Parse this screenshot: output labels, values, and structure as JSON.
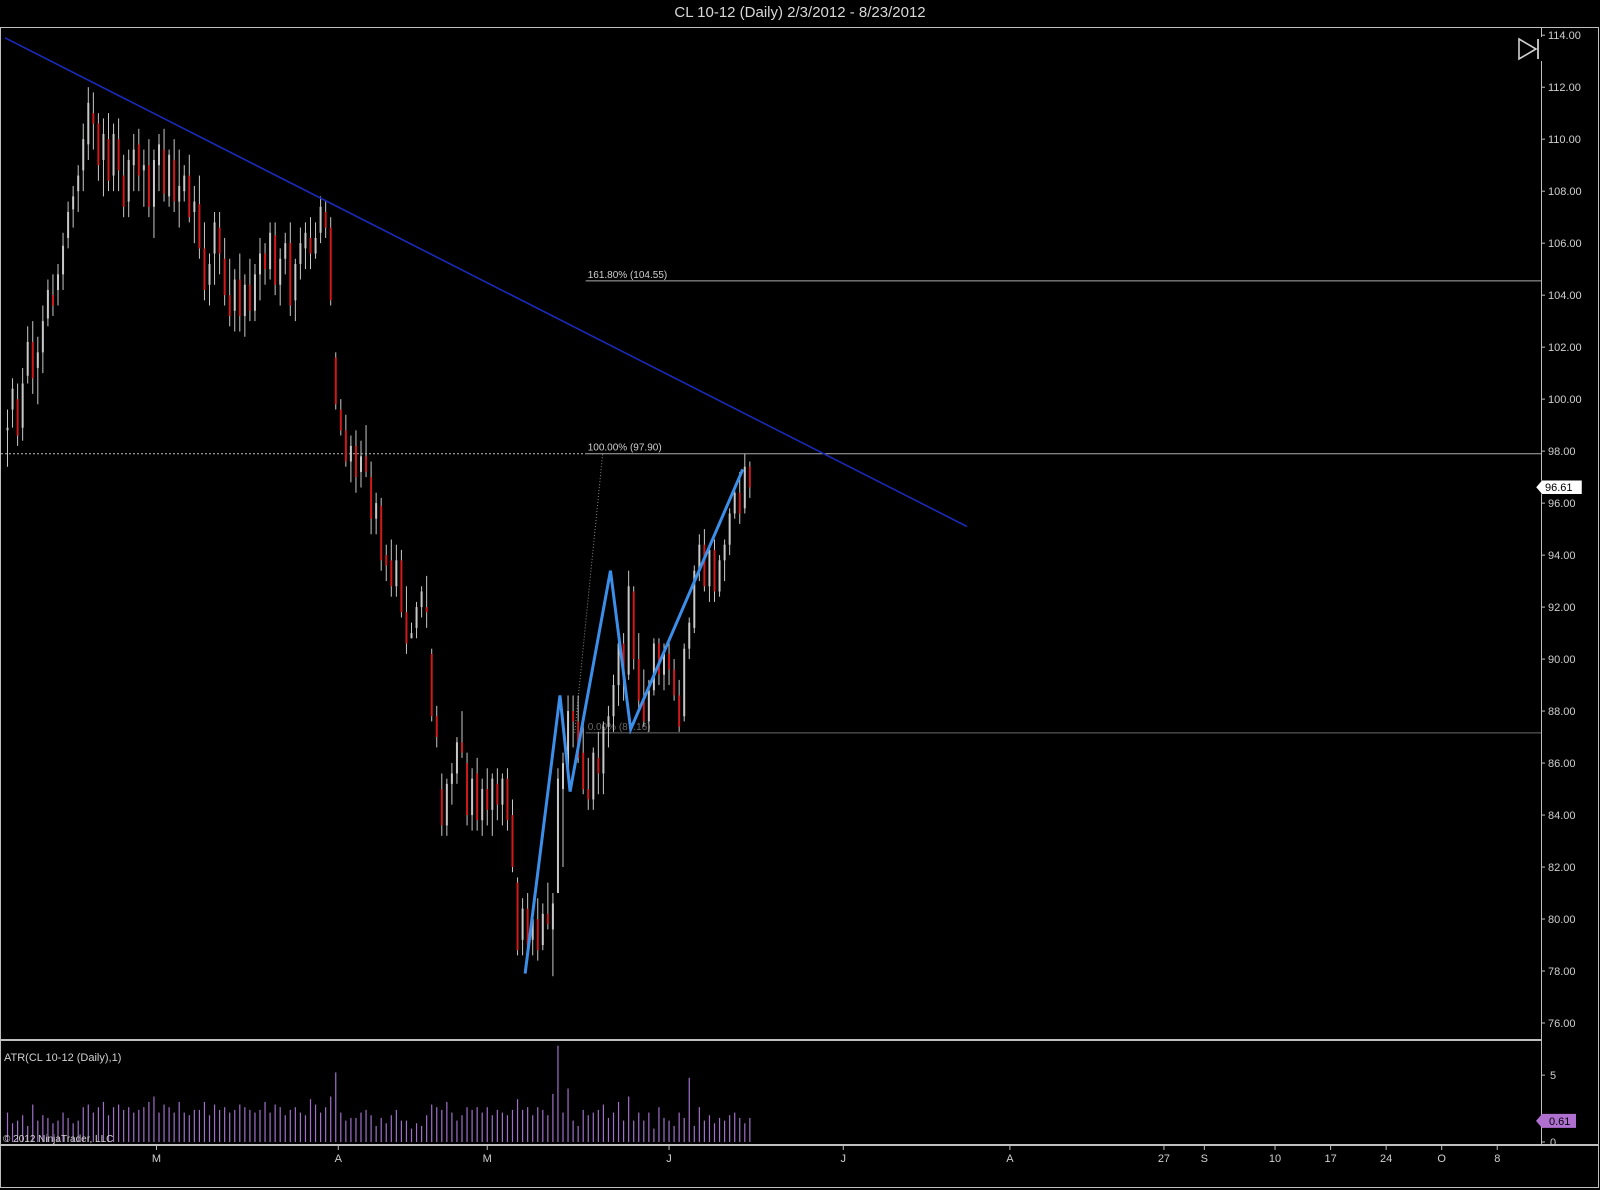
{
  "window": {
    "title": "CL 10-12 (Daily)  2/3/2012 - 8/23/2012"
  },
  "colors": {
    "background": "#000000",
    "up_bar": "#c8c8c8",
    "down_bar": "#d01a1a",
    "trendline": "#1a2ab8",
    "zigzag": "#3b8fe8",
    "fib": "#c0c0c0",
    "atr": "#a070c8",
    "price_marker": "#ffffff",
    "atr_marker": "#b070d0"
  },
  "chart_data": [
    {
      "type": "ohlc",
      "title": "CL 10-12 (Daily)  2/3/2012 - 8/23/2012",
      "ylim": [
        75.5,
        114.2
      ],
      "y_ticks": [
        "114.00",
        "112.00",
        "110.00",
        "108.00",
        "106.00",
        "104.00",
        "102.00",
        "100.00",
        "98.00",
        "96.00",
        "94.00",
        "92.00",
        "90.00",
        "88.00",
        "86.00",
        "84.00",
        "82.00",
        "80.00",
        "78.00",
        "76.00"
      ],
      "x_labels": [
        "M",
        "A",
        "M",
        "J",
        "J",
        "A",
        "27",
        "S",
        "10",
        "17",
        "24",
        "O",
        "8"
      ],
      "bars": [
        [
          98.8,
          99.6,
          97.4,
          98.9
        ],
        [
          99.6,
          100.8,
          98.9,
          100.4
        ],
        [
          100.0,
          100.6,
          98.2,
          98.6
        ],
        [
          98.9,
          101.2,
          98.4,
          100.6
        ],
        [
          100.9,
          102.8,
          100.6,
          102.2
        ],
        [
          102.2,
          103.0,
          100.2,
          100.8
        ],
        [
          101.2,
          102.4,
          99.8,
          101.8
        ],
        [
          101.8,
          103.6,
          101.0,
          103.0
        ],
        [
          103.1,
          104.6,
          102.8,
          104.2
        ],
        [
          104.0,
          104.8,
          103.2,
          103.6
        ],
        [
          104.2,
          105.2,
          103.6,
          104.8
        ],
        [
          104.8,
          106.4,
          104.2,
          105.9
        ],
        [
          106.2,
          107.6,
          105.8,
          107.2
        ],
        [
          107.3,
          108.2,
          106.6,
          107.8
        ],
        [
          108.0,
          109.0,
          107.2,
          108.6
        ],
        [
          108.8,
          110.6,
          108.0,
          110.0
        ],
        [
          109.8,
          112.0,
          109.2,
          111.4
        ],
        [
          111.0,
          111.8,
          109.6,
          110.6
        ],
        [
          110.6,
          111.0,
          108.4,
          109.0
        ],
        [
          109.2,
          110.8,
          107.8,
          110.2
        ],
        [
          110.0,
          111.0,
          108.0,
          108.4
        ],
        [
          108.6,
          110.6,
          108.0,
          110.2
        ],
        [
          110.0,
          110.8,
          108.0,
          108.8
        ],
        [
          108.6,
          109.4,
          107.0,
          107.4
        ],
        [
          107.6,
          109.6,
          107.0,
          109.2
        ],
        [
          109.0,
          110.2,
          108.0,
          109.6
        ],
        [
          109.8,
          110.4,
          108.0,
          108.6
        ],
        [
          108.8,
          109.6,
          107.4,
          109.0
        ],
        [
          109.0,
          110.0,
          107.0,
          107.4
        ],
        [
          107.4,
          109.6,
          106.2,
          109.2
        ],
        [
          109.0,
          110.2,
          108.0,
          109.8
        ],
        [
          109.6,
          110.4,
          107.6,
          107.9
        ],
        [
          107.8,
          109.6,
          107.4,
          109.4
        ],
        [
          109.2,
          110.0,
          107.2,
          107.6
        ],
        [
          107.6,
          109.6,
          106.6,
          108.2
        ],
        [
          108.0,
          109.0,
          107.6,
          108.6
        ],
        [
          108.6,
          109.4,
          106.8,
          107.0
        ],
        [
          107.2,
          108.2,
          106.0,
          107.6
        ],
        [
          107.5,
          108.6,
          105.4,
          105.8
        ],
        [
          105.8,
          106.8,
          103.8,
          104.2
        ],
        [
          104.4,
          105.6,
          103.6,
          105.2
        ],
        [
          105.6,
          107.2,
          104.4,
          106.8
        ],
        [
          106.6,
          107.2,
          104.8,
          105.6
        ],
        [
          105.4,
          106.2,
          103.6,
          104.0
        ],
        [
          104.0,
          105.4,
          102.8,
          103.2
        ],
        [
          103.4,
          105.0,
          102.6,
          104.6
        ],
        [
          104.6,
          105.6,
          102.6,
          103.2
        ],
        [
          103.2,
          104.8,
          102.4,
          104.4
        ],
        [
          104.4,
          105.4,
          103.0,
          103.4
        ],
        [
          103.4,
          105.2,
          103.0,
          104.8
        ],
        [
          104.8,
          106.2,
          103.8,
          105.6
        ],
        [
          105.6,
          106.0,
          104.4,
          105.0
        ],
        [
          105.0,
          106.8,
          104.6,
          106.4
        ],
        [
          106.3,
          106.8,
          104.0,
          104.4
        ],
        [
          104.4,
          105.8,
          103.6,
          105.4
        ],
        [
          105.4,
          106.4,
          104.8,
          106.0
        ],
        [
          106.0,
          106.8,
          103.2,
          103.6
        ],
        [
          103.8,
          105.4,
          103.0,
          105.2
        ],
        [
          105.2,
          106.6,
          104.6,
          106.0
        ],
        [
          105.8,
          106.8,
          105.0,
          106.4
        ],
        [
          106.2,
          107.0,
          105.0,
          105.6
        ],
        [
          105.6,
          106.8,
          105.4,
          106.2
        ],
        [
          106.4,
          107.8,
          106.0,
          107.4
        ],
        [
          107.2,
          107.6,
          106.2,
          106.6
        ],
        [
          106.6,
          107.0,
          103.6,
          103.8
        ],
        [
          101.6,
          101.8,
          99.6,
          99.8
        ],
        [
          99.6,
          100.0,
          98.6,
          98.8
        ],
        [
          98.8,
          99.4,
          97.4,
          97.6
        ],
        [
          97.6,
          98.6,
          96.8,
          98.2
        ],
        [
          98.2,
          98.8,
          96.4,
          97.0
        ],
        [
          97.2,
          98.4,
          96.6,
          97.8
        ],
        [
          97.8,
          99.0,
          97.0,
          97.2
        ],
        [
          97.0,
          97.6,
          94.8,
          95.4
        ],
        [
          95.4,
          96.4,
          94.8,
          96.0
        ],
        [
          95.9,
          96.2,
          93.4,
          93.8
        ],
        [
          94.0,
          94.4,
          93.0,
          93.6
        ],
        [
          93.8,
          94.6,
          92.4,
          92.8
        ],
        [
          92.8,
          94.4,
          92.4,
          93.8
        ],
        [
          93.8,
          94.2,
          91.6,
          91.8
        ],
        [
          91.8,
          92.8,
          90.2,
          90.6
        ],
        [
          90.8,
          91.4,
          90.8,
          91.0
        ],
        [
          91.2,
          92.2,
          90.8,
          92.0
        ],
        [
          92.0,
          92.8,
          91.6,
          92.6
        ],
        [
          92.0,
          93.2,
          91.2,
          91.8
        ],
        [
          90.2,
          90.4,
          87.6,
          87.8
        ],
        [
          87.8,
          88.2,
          86.6,
          87.0
        ],
        [
          85.0,
          85.6,
          83.2,
          83.6
        ],
        [
          83.6,
          85.4,
          83.2,
          85.2
        ],
        [
          85.2,
          86.0,
          84.4,
          85.6
        ],
        [
          85.6,
          87.0,
          85.2,
          86.8
        ],
        [
          86.8,
          88.0,
          86.2,
          86.4
        ],
        [
          86.0,
          86.4,
          83.6,
          84.0
        ],
        [
          84.0,
          85.8,
          83.4,
          85.4
        ],
        [
          85.6,
          86.2,
          83.4,
          83.8
        ],
        [
          83.8,
          85.4,
          83.2,
          85.0
        ],
        [
          85.0,
          85.8,
          83.6,
          84.2
        ],
        [
          84.2,
          85.6,
          83.2,
          85.4
        ],
        [
          85.2,
          85.8,
          83.8,
          84.4
        ],
        [
          84.4,
          85.6,
          83.6,
          85.4
        ],
        [
          85.4,
          85.8,
          83.4,
          83.8
        ],
        [
          84.0,
          84.6,
          81.8,
          82.0
        ],
        [
          81.4,
          81.6,
          78.6,
          78.8
        ],
        [
          79.2,
          80.8,
          78.6,
          80.4
        ],
        [
          80.4,
          81.0,
          78.4,
          79.0
        ],
        [
          79.2,
          80.4,
          78.6,
          80.0
        ],
        [
          80.0,
          80.8,
          78.4,
          78.8
        ],
        [
          79.0,
          80.6,
          78.8,
          80.2
        ],
        [
          80.2,
          81.4,
          79.6,
          79.8
        ],
        [
          79.6,
          81.0,
          77.8,
          80.6
        ],
        [
          81.0,
          85.8,
          81.0,
          85.4
        ],
        [
          85.0,
          86.4,
          82.0,
          86.0
        ],
        [
          85.8,
          88.6,
          85.4,
          88.0
        ],
        [
          88.0,
          88.6,
          86.6,
          87.6
        ],
        [
          87.6,
          88.6,
          86.0,
          86.2
        ],
        [
          86.4,
          87.6,
          84.8,
          85.0
        ],
        [
          85.0,
          86.2,
          84.2,
          84.6
        ],
        [
          84.6,
          86.6,
          84.2,
          86.4
        ],
        [
          86.2,
          87.2,
          84.8,
          85.6
        ],
        [
          85.6,
          87.6,
          84.8,
          87.4
        ],
        [
          87.4,
          88.2,
          86.6,
          87.8
        ],
        [
          87.8,
          89.4,
          87.2,
          89.0
        ],
        [
          89.0,
          91.2,
          88.2,
          90.6
        ],
        [
          90.6,
          91.0,
          88.4,
          89.2
        ],
        [
          89.4,
          93.4,
          89.2,
          92.8
        ],
        [
          92.6,
          92.8,
          89.6,
          90.0
        ],
        [
          90.0,
          91.0,
          88.0,
          88.4
        ],
        [
          88.4,
          89.6,
          87.4,
          87.6
        ],
        [
          87.6,
          89.2,
          87.2,
          88.8
        ],
        [
          88.8,
          90.8,
          88.6,
          90.6
        ],
        [
          90.6,
          90.8,
          89.0,
          89.4
        ],
        [
          89.4,
          90.6,
          88.8,
          90.2
        ],
        [
          90.2,
          90.8,
          89.0,
          89.6
        ],
        [
          89.6,
          90.0,
          88.4,
          88.6
        ],
        [
          88.6,
          89.2,
          87.2,
          87.4
        ],
        [
          87.8,
          90.6,
          87.6,
          90.4
        ],
        [
          90.4,
          91.6,
          90.0,
          91.4
        ],
        [
          91.2,
          93.6,
          91.0,
          93.4
        ],
        [
          93.4,
          94.8,
          93.0,
          94.4
        ],
        [
          94.4,
          95.0,
          92.6,
          92.8
        ],
        [
          92.8,
          94.4,
          92.2,
          94.2
        ],
        [
          94.2,
          94.6,
          92.2,
          92.6
        ],
        [
          92.6,
          94.0,
          92.4,
          93.8
        ],
        [
          93.8,
          94.6,
          93.0,
          94.4
        ],
        [
          94.4,
          95.8,
          94.0,
          95.6
        ],
        [
          95.6,
          96.6,
          95.4,
          96.4
        ],
        [
          96.4,
          97.2,
          95.2,
          95.6
        ],
        [
          95.8,
          97.9,
          95.6,
          97.4
        ],
        [
          97.4,
          97.6,
          96.2,
          96.6
        ]
      ],
      "trendline": {
        "from": [
          -0.5,
          113.9
        ],
        "to": [
          190.0,
          95.1
        ]
      },
      "zigzag": [
        [
          102.5,
          77.9
        ],
        [
          109.4,
          88.6
        ],
        [
          111.4,
          84.9
        ],
        [
          119.4,
          93.4
        ],
        [
          123.4,
          87.3
        ],
        [
          145.6,
          97.3
        ]
      ],
      "fib_levels": [
        {
          "label": "161.80% (104.55)",
          "value": 104.55
        },
        {
          "label": "100.00% (97.90)",
          "value": 97.9
        },
        {
          "label": "0.00% (87.16)",
          "value": 87.16
        }
      ],
      "fib_start_index": 114.5,
      "current_price": 96.61,
      "price_marker_label": "96.61",
      "horizontal_dotted_line": 97.9
    },
    {
      "type": "bar",
      "title": "ATR(CL 10-12 (Daily),1)",
      "ylim": [
        0,
        7.4
      ],
      "y_ticks": [
        "5",
        "0"
      ],
      "values": [
        2.2,
        1.4,
        1.6,
        2.0,
        1.2,
        2.8,
        1.6,
        2.0,
        1.8,
        1.4,
        1.6,
        2.2,
        1.8,
        1.4,
        1.6,
        2.6,
        2.8,
        2.2,
        2.6,
        3.0,
        2.0,
        2.6,
        2.8,
        2.4,
        2.6,
        2.2,
        2.4,
        2.6,
        3.0,
        3.4,
        2.2,
        2.8,
        2.6,
        2.2,
        3.0,
        2.2,
        2.0,
        2.4,
        2.4,
        3.0,
        2.0,
        2.8,
        2.4,
        2.6,
        2.2,
        2.4,
        2.8,
        2.6,
        2.4,
        2.2,
        2.4,
        3.0,
        2.2,
        2.8,
        2.6,
        2.0,
        2.4,
        2.6,
        2.2,
        2.0,
        3.2,
        2.8,
        2.2,
        2.6,
        3.4,
        5.2,
        2.2,
        1.6,
        1.8,
        1.8,
        2.2,
        2.4,
        2.0,
        1.2,
        1.8,
        1.4,
        2.0,
        2.4,
        1.6,
        1.6,
        1.0,
        1.4,
        1.2,
        2.0,
        2.8,
        2.6,
        2.4,
        3.0,
        2.2,
        1.6,
        2.0,
        2.6,
        2.4,
        2.6,
        2.2,
        2.6,
        2.0,
        2.4,
        2.2,
        2.0,
        2.4,
        3.2,
        2.4,
        2.6,
        2.0,
        2.6,
        2.4,
        2.0,
        3.6,
        7.2,
        2.2,
        4.0,
        1.6,
        1.2,
        2.4,
        2.0,
        2.2,
        2.4,
        2.8,
        1.8,
        2.2,
        3.0,
        1.6,
        3.4,
        1.6,
        2.2,
        1.6,
        2.2,
        1.0,
        2.6,
        1.8,
        1.6,
        1.2,
        2.2,
        1.8,
        4.8,
        1.2,
        2.6,
        1.6,
        2.0,
        1.4,
        1.8,
        1.6,
        2.0,
        2.2,
        1.8,
        1.4,
        1.8
      ],
      "current_value_label": "0.61"
    }
  ],
  "footer": {
    "copyright": "© 2012 NinjaTrader, LLC"
  },
  "icons": {
    "jump_to_end": "skip-to-end-icon"
  }
}
